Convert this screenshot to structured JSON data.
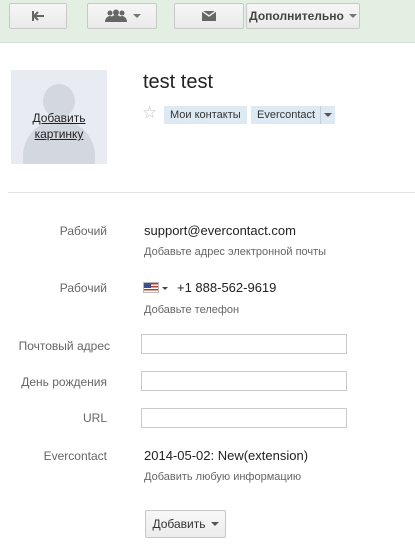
{
  "toolbar": {
    "more_label": "Дополнительно"
  },
  "contact": {
    "name": "test test",
    "photo_link": "Добавить картинку",
    "chips": [
      "Мои контакты",
      "Evercontact"
    ]
  },
  "fields": {
    "email_label": "Рабочий",
    "email_value": "support@evercontact.com",
    "email_hint": "Добавьте адрес электронной почты",
    "phone_label": "Рабочий",
    "phone_value": "+1 888-562-9619",
    "phone_hint": "Добавьте телефон",
    "address_label": "Почтовый адрес",
    "birthday_label": "День рождения",
    "url_label": "URL",
    "custom_label": "Evercontact",
    "custom_value": "2014-05-02: New(extension)",
    "custom_hint": "Добавить любую информацию"
  },
  "add_button": "Добавить",
  "icons": [
    "back-arrow-icon",
    "people-icon",
    "mail-icon",
    "star-icon",
    "us-flag-icon"
  ]
}
